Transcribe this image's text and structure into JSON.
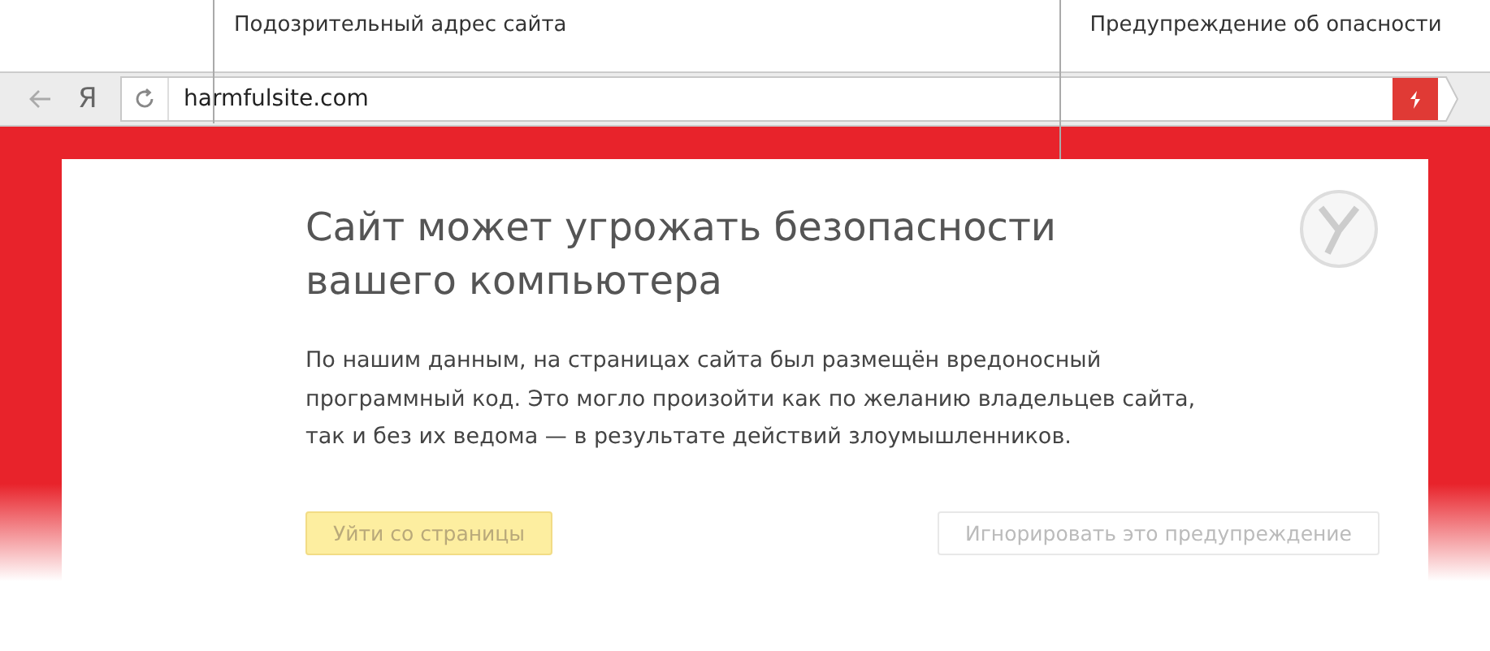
{
  "annotations": [
    {
      "text": "Подозрительный адрес сайта"
    },
    {
      "text": "Предупреждение об опасности"
    }
  ],
  "toolbar": {
    "logo": "Я",
    "address": "harmfulsite.com"
  },
  "warning": {
    "title": "Сайт может угрожать безопасности вашего компьютера",
    "body": "По нашим данным, на страницах сайта был размещён вредоносный программный код. Это могло произойти как по желанию владельцев сайта, так и без их ведома — в результате действий злоумышленников.",
    "buttons": [
      {
        "kind": "primary",
        "label": "Уйти со страницы"
      },
      {
        "kind": "secondary",
        "label": "Игнорировать это предупреждение"
      }
    ]
  }
}
